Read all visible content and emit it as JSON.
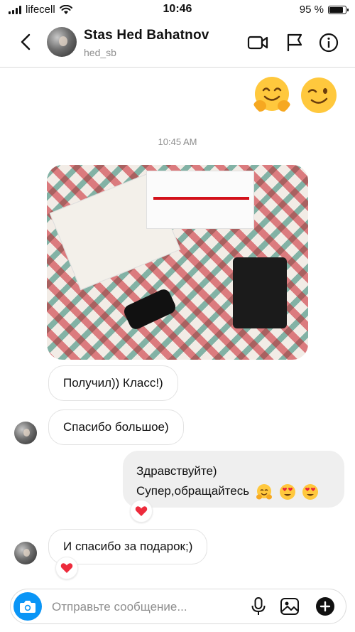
{
  "status_bar": {
    "carrier": "lifecell",
    "time": "10:46",
    "battery": "95 %",
    "battery_level": 0.95
  },
  "header": {
    "name": "Stas Hed Bahatnov",
    "username": "hed_sb"
  },
  "thread": {
    "timestamp": "10:45 AM",
    "messages": [
      {
        "text": "Получил)) Класс!)"
      },
      {
        "text": "Спасибо большое)"
      },
      {
        "line1": "Здравствуйте)",
        "line2": "Супер,обращайтесь"
      },
      {
        "text": "И спасибо за подарок;)"
      }
    ]
  },
  "composer": {
    "placeholder": "Отправьте сообщение..."
  },
  "colors": {
    "accent": "#0a95f6",
    "heart": "#ed2b3c",
    "my_bubble": "#efefef"
  }
}
